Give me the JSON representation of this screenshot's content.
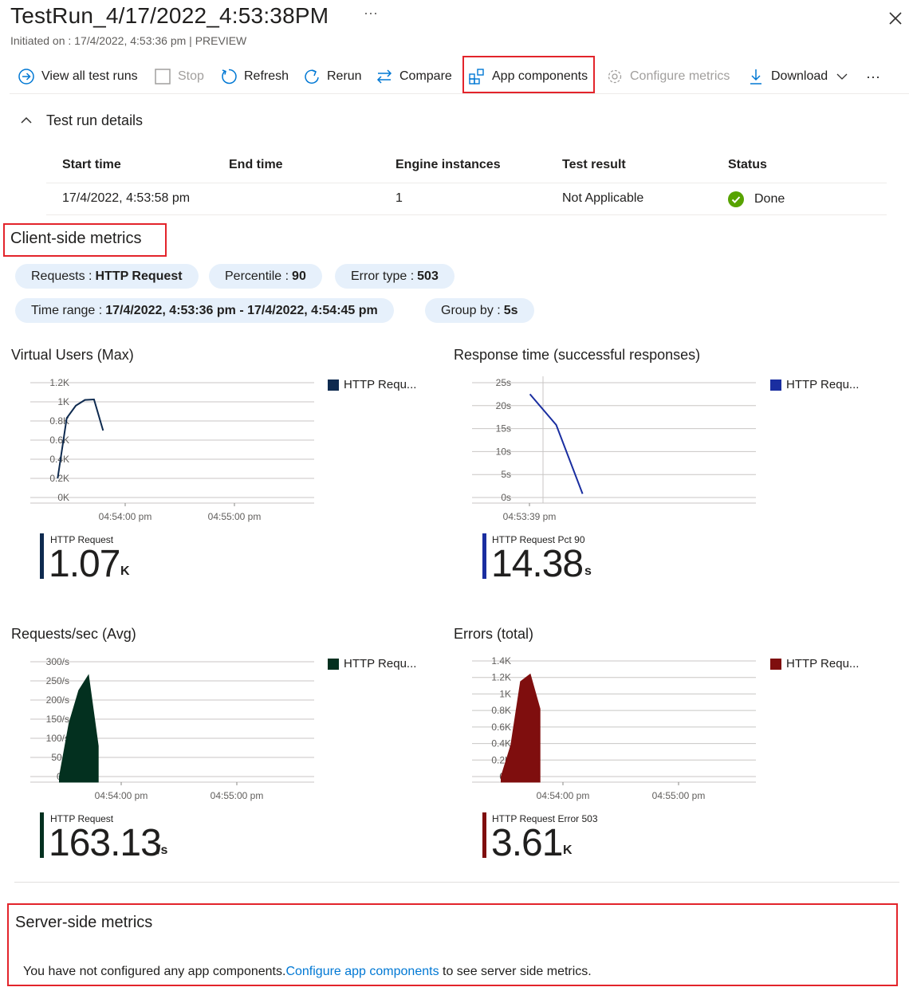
{
  "header": {
    "title": "TestRun_4/17/2022_4:53:38PM",
    "more": "···",
    "subtitle": "Initiated on : 17/4/2022, 4:53:36 pm | PREVIEW"
  },
  "toolbar": {
    "view_all": "View all test runs",
    "stop": "Stop",
    "refresh": "Refresh",
    "rerun": "Rerun",
    "compare": "Compare",
    "app_components": "App components",
    "configure_metrics": "Configure metrics",
    "download": "Download",
    "more": "···"
  },
  "details": {
    "toggle_label": "Test run details",
    "columns": [
      "Start time",
      "End time",
      "Engine instances",
      "Test result",
      "Status"
    ],
    "row": {
      "start_time": "17/4/2022, 4:53:58 pm",
      "end_time": "",
      "engine_instances": "1",
      "test_result": "Not Applicable",
      "status": "Done"
    }
  },
  "client_metrics": {
    "title": "Client-side metrics",
    "filters": {
      "requests": {
        "label": "Requests :",
        "value": "HTTP Request"
      },
      "percentile": {
        "label": "Percentile :",
        "value": "90"
      },
      "error_type": {
        "label": "Error type :",
        "value": "503"
      },
      "time_range": {
        "label": "Time range :",
        "value": "17/4/2022, 4:53:36 pm - 17/4/2022, 4:54:45 pm"
      },
      "group_by": {
        "label": "Group by :",
        "value": "5s"
      }
    }
  },
  "charts": [
    {
      "title": "Virtual Users (Max)",
      "legend": "HTTP Requ...",
      "kpi_label": "HTTP Request",
      "kpi_value": "1.07",
      "kpi_unit": "K",
      "color": "#0e2a4f"
    },
    {
      "title": "Response time (successful responses)",
      "legend": "HTTP Requ...",
      "kpi_label": "HTTP Request Pct 90",
      "kpi_value": "14.38",
      "kpi_unit": "s",
      "color": "#1a2ea0"
    },
    {
      "title": "Requests/sec (Avg)",
      "legend": "HTTP Requ...",
      "kpi_label": "HTTP Request",
      "kpi_value": "163.13",
      "kpi_unit": "/s",
      "color": "#03301f"
    },
    {
      "title": "Errors (total)",
      "legend": "HTTP Requ...",
      "kpi_label": "HTTP Request Error 503",
      "kpi_value": "3.61",
      "kpi_unit": "K",
      "color": "#7f0e0e"
    }
  ],
  "chart_data": [
    {
      "type": "line",
      "title": "Virtual Users (Max)",
      "series": [
        {
          "name": "HTTP Requ...",
          "x": [
            "04:53:55",
            "04:54:00",
            "04:54:05",
            "04:54:10",
            "04:54:15",
            "04:54:20"
          ],
          "values": [
            200,
            830,
            960,
            1020,
            1025,
            700
          ]
        }
      ],
      "yticks": [
        "0K",
        "0.2K",
        "0.4K",
        "0.6K",
        "0.8K",
        "1K",
        "1.2K"
      ],
      "xticks": [
        "04:54:00 pm",
        "04:55:00 pm"
      ],
      "ylim": [
        0,
        1200
      ]
    },
    {
      "type": "line",
      "title": "Response time (successful responses)",
      "series": [
        {
          "name": "HTTP Requ...",
          "x": [
            "04:53:50",
            "04:53:55",
            "04:54:00"
          ],
          "values": [
            22.5,
            15.8,
            0.8
          ]
        }
      ],
      "yticks": [
        "0s",
        "5s",
        "10s",
        "15s",
        "20s",
        "25s"
      ],
      "xticks": [
        "04:53:39 pm"
      ],
      "ylim": [
        0,
        25
      ]
    },
    {
      "type": "area",
      "title": "Requests/sec (Avg)",
      "series": [
        {
          "name": "HTTP Requ...",
          "x": [
            "04:53:55",
            "04:54:00",
            "04:54:05",
            "04:54:10",
            "04:54:15"
          ],
          "values": [
            0,
            140,
            225,
            265,
            80
          ]
        }
      ],
      "yticks": [
        "0/s",
        "50/s",
        "100/s",
        "150/s",
        "200/s",
        "250/s",
        "300/s"
      ],
      "xticks": [
        "04:54:00 pm",
        "04:55:00 pm"
      ],
      "ylim": [
        0,
        300
      ]
    },
    {
      "type": "area",
      "title": "Errors (total)",
      "series": [
        {
          "name": "HTTP Requ...",
          "x": [
            "04:53:55",
            "04:54:00",
            "04:54:05",
            "04:54:10",
            "04:54:15"
          ],
          "values": [
            0,
            380,
            1150,
            1240,
            820
          ]
        }
      ],
      "yticks": [
        "0K",
        "0.2K",
        "0.4K",
        "0.6K",
        "0.8K",
        "1K",
        "1.2K",
        "1.4K"
      ],
      "xticks": [
        "04:54:00 pm",
        "04:55:00 pm"
      ],
      "ylim": [
        0,
        1400
      ]
    }
  ],
  "server_metrics": {
    "title": "Server-side metrics",
    "message_prefix": "You have not configured any app components.",
    "link": "Configure app components",
    "message_suffix": " to see server side metrics."
  }
}
